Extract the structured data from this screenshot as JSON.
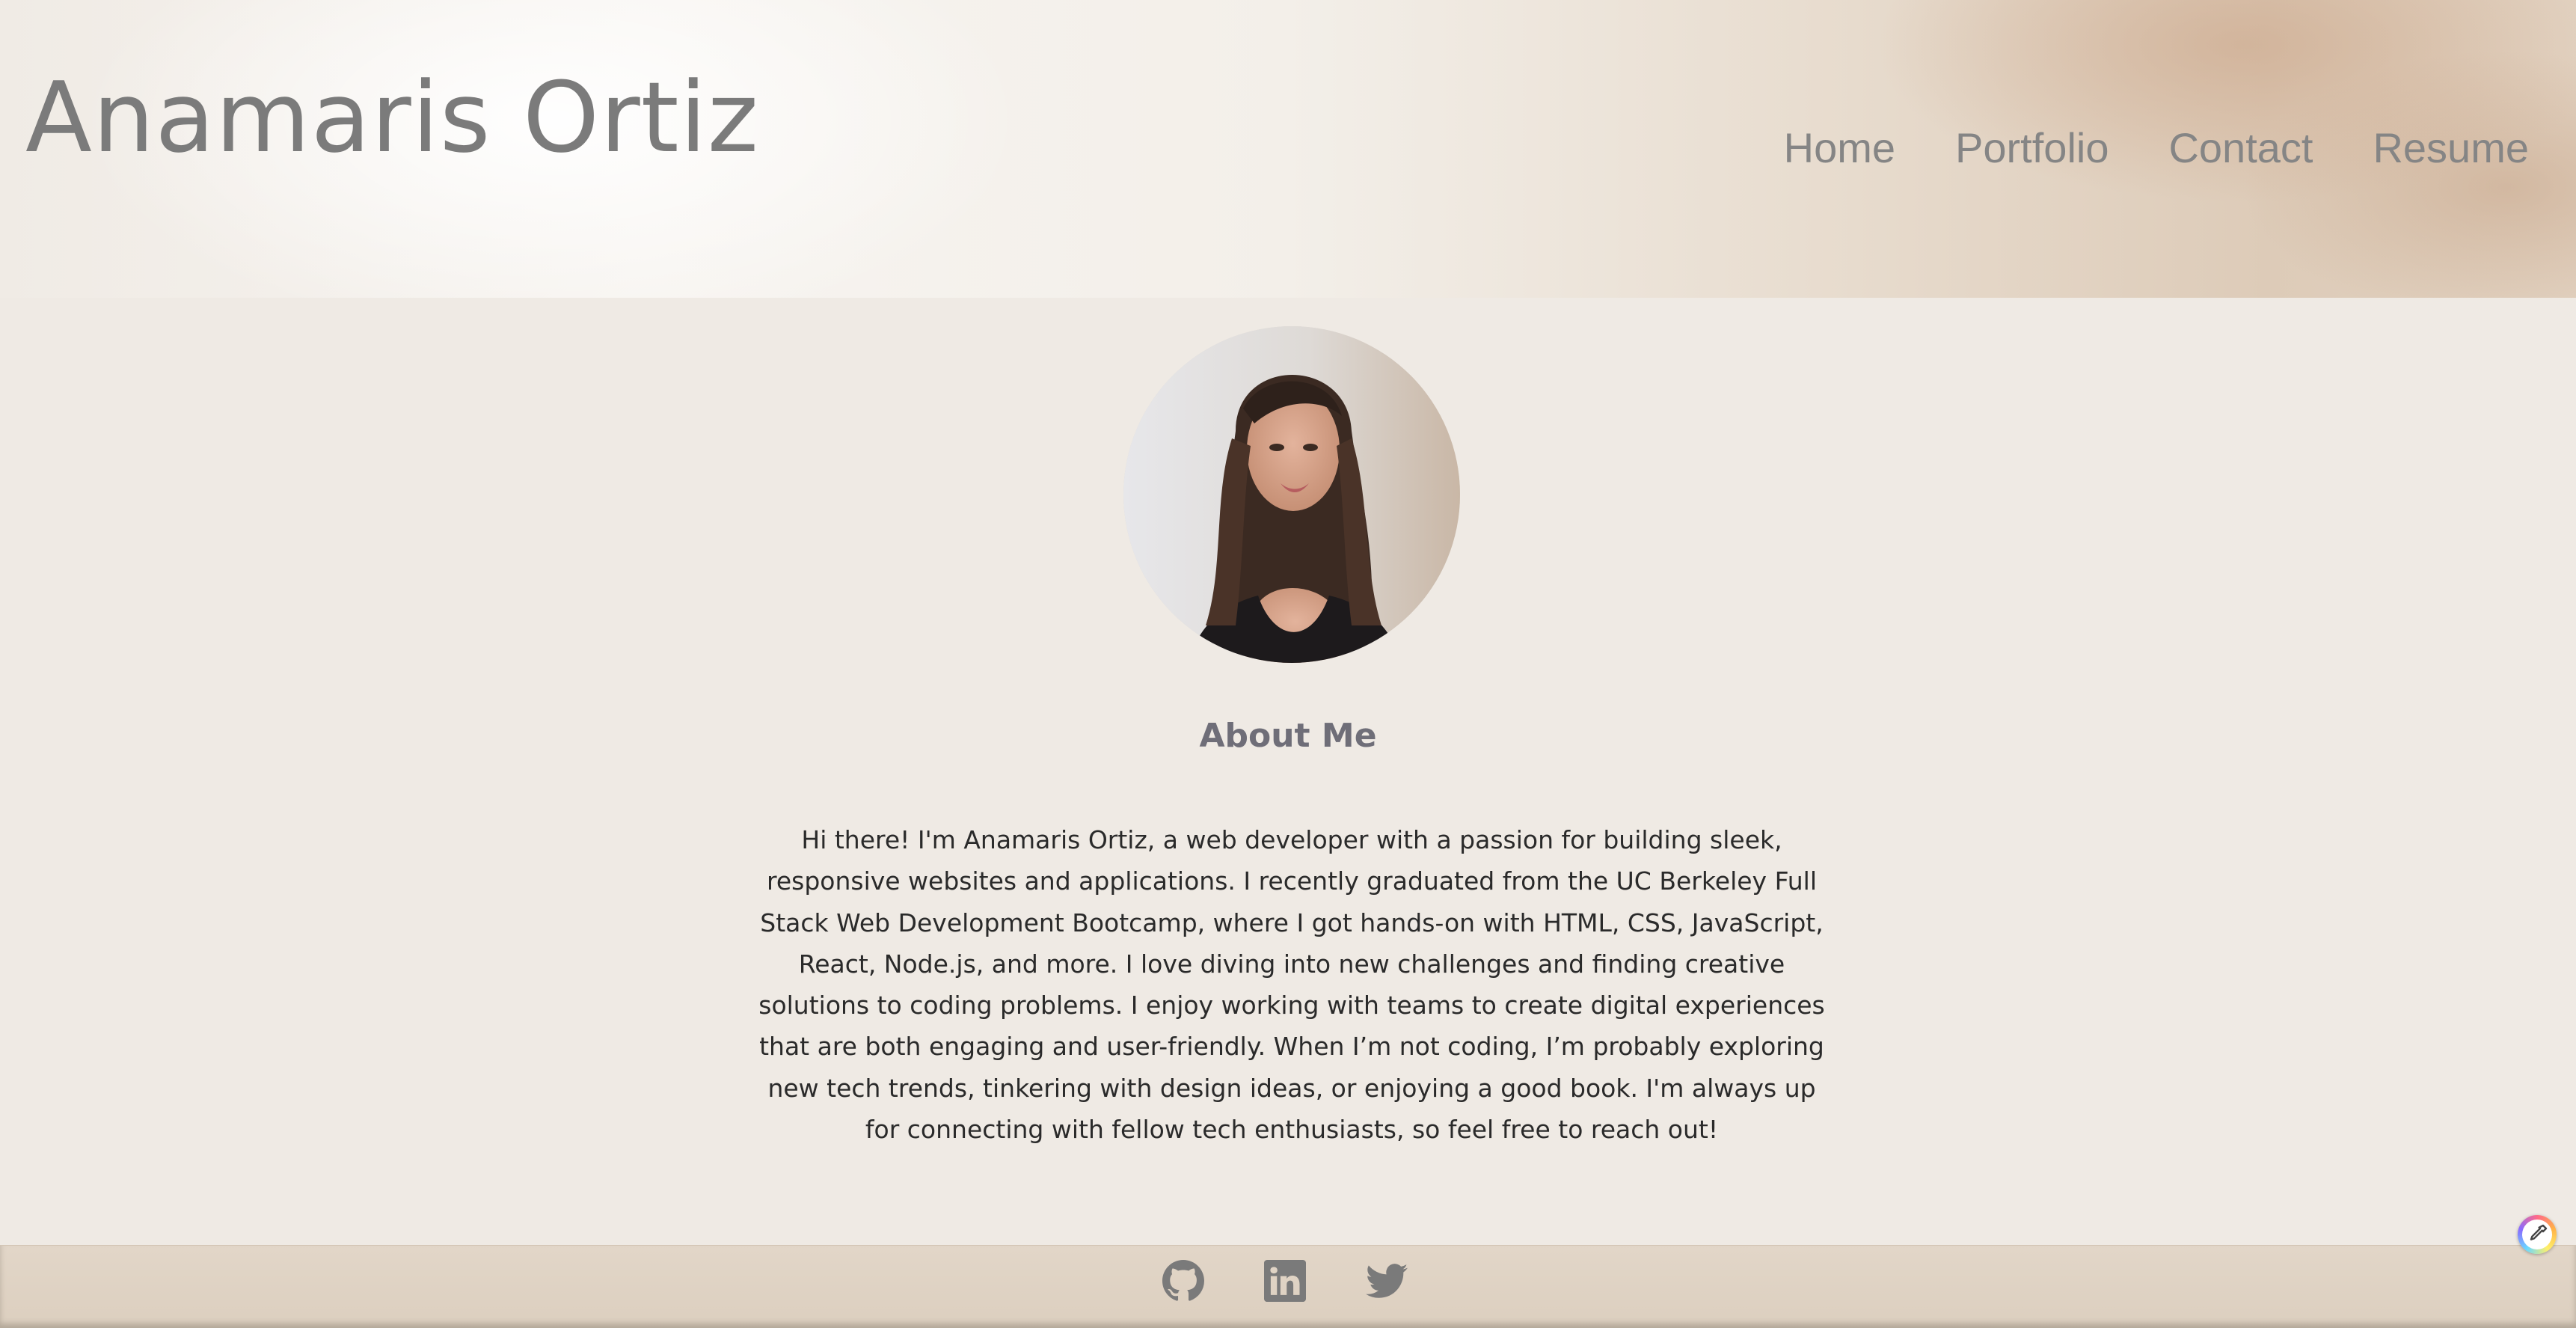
{
  "header": {
    "title": "Anamaris Ortiz",
    "nav": [
      "Home",
      "Portfolio",
      "Contact",
      "Resume"
    ]
  },
  "main": {
    "avatar_alt": "portrait-photo",
    "about_heading": "About Me",
    "about_text": "Hi there! I'm Anamaris Ortiz, a web developer with a passion for building sleek, responsive websites and applications. I recently graduated from the UC Berkeley Full Stack Web Development Bootcamp, where I got hands-on with HTML, CSS, JavaScript, React, Node.js, and more. I love diving into new challenges and finding creative solutions to coding problems. I enjoy working with teams to create digital experiences that are both engaging and user-friendly. When I’m not coding, I’m probably exploring new tech trends, tinkering with design ideas, or enjoying a good book. I'm always up for connecting with fellow tech enthusiasts, so feel free to reach out!"
  },
  "footer": {
    "social_icons": [
      "github-icon",
      "linkedin-icon",
      "twitter-icon"
    ]
  },
  "colors": {
    "page_bg": "#efeae4",
    "title_text": "#7b7b7b",
    "nav_text": "#858585",
    "heading_text": "#6f6e78",
    "body_text": "#2a2a2a",
    "icon_gray": "#7a7a7a"
  }
}
